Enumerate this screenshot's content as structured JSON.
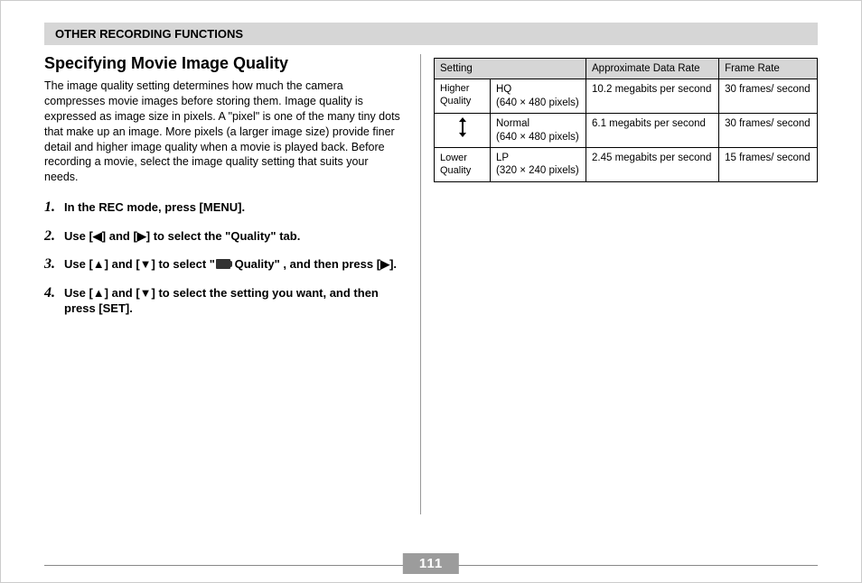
{
  "header": {
    "title": "OTHER RECORDING FUNCTIONS"
  },
  "section": {
    "title": "Specifying Movie Image Quality",
    "body": "The image quality setting determines how much the camera compresses movie images before storing them. Image quality is expressed as image size in pixels. A \"pixel\" is one of the many tiny dots that make up an image. More pixels (a larger image size) provide finer detail and higher image quality when a movie is played back. Before recording a movie, select the image quality setting that suits your needs."
  },
  "steps": {
    "s1": "In the REC mode, press [MENU].",
    "s2": "Use [◀] and [▶] to select the \"Quality\" tab.",
    "s3a": "Use [▲] and [▼] to select \"",
    "s3b": " Quality\" , and then press [▶].",
    "s4": "Use [▲] and [▼] to select the setting you want, and then press [SET]."
  },
  "table": {
    "h1": "Setting",
    "h2": "Approximate Data Rate",
    "h3": "Frame Rate",
    "higher_label": "Higher Quality",
    "lower_label": "Lower Quality",
    "rows": [
      {
        "mode": "HQ",
        "size": "(640 × 480 pixels)",
        "rate": "10.2 megabits per second",
        "fps": "30 frames/ second"
      },
      {
        "mode": "Normal",
        "size": "(640 × 480 pixels)",
        "rate": "6.1 megabits per second",
        "fps": "30 frames/ second"
      },
      {
        "mode": "LP",
        "size": "(320 × 240 pixels)",
        "rate": "2.45 megabits per second",
        "fps": "15 frames/ second"
      }
    ]
  },
  "page_number": "111"
}
